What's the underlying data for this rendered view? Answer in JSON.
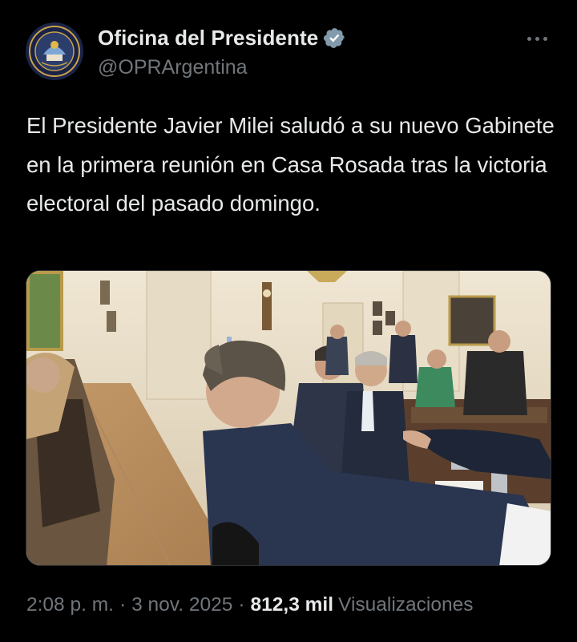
{
  "author": {
    "display_name": "Oficina del Presidente",
    "handle": "@OPRArgentina",
    "avatar_icon": "presidential-seal",
    "verified_icon": "verified-badge-icon",
    "verified_color": "#829aab"
  },
  "tweet": {
    "text": "El Presidente Javier Milei saludó a su nuevo Gabinete en la primera reunión en Casa Rosada tras la victoria electoral del pasado domingo."
  },
  "media": {
    "type": "photo"
  },
  "meta": {
    "time": "2:08 p. m.",
    "separator": "·",
    "date": "3 nov. 2025",
    "views_count": "812,3 mil",
    "views_label": "Visualizaciones"
  },
  "colors": {
    "background": "#000000",
    "text_primary": "#e7e9ea",
    "text_secondary": "#71767b"
  }
}
